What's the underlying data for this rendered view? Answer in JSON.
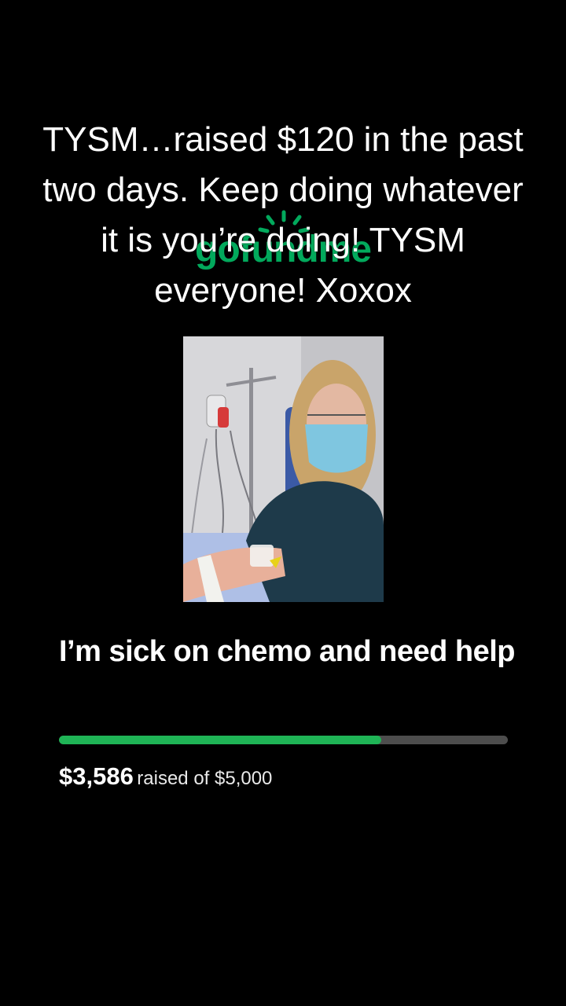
{
  "overlay_caption": "TYSM…raised $120 in the past two days. Keep doing whatever it is you’re doing! TYSM everyone! Xoxox",
  "logo": {
    "text": "gofundme",
    "icon": "gofundme-sun-icon",
    "color": "#02a95c"
  },
  "photo": {
    "subject": "patient-receiving-chemo-photo"
  },
  "campaign": {
    "title": "I’m sick on chemo and need help",
    "raised_amount": "$3,586",
    "raised_of_text": "raised of $5,000",
    "progress_fraction": 0.7172
  },
  "colors": {
    "background": "#000000",
    "progress_fill": "#1fb456",
    "progress_track": "#4d4d4d"
  }
}
